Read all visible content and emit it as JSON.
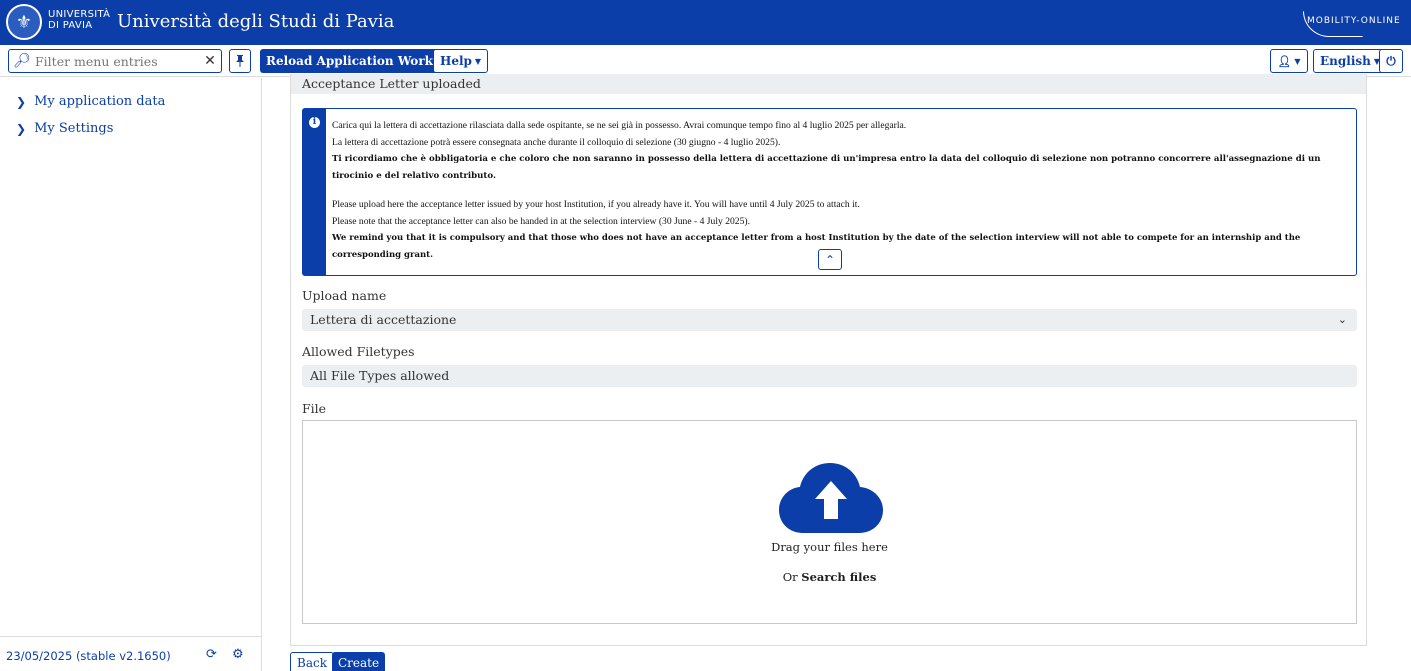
{
  "header": {
    "uni_small_line1": "UNIVERSITÀ",
    "uni_small_line2": "DI PAVIA",
    "title": "Università degli Studi di Pavia",
    "brand_logo_text": "MOBILITY-ONLINE",
    "brand_color": "#0b3ea8"
  },
  "toolbar": {
    "filter_placeholder": "Filter menu entries",
    "clear_icon": "close-icon",
    "pin_icon": "pin-icon",
    "reload_label": "Reload Application Workflow",
    "help_label": "Help",
    "user_icon": "user-settings-icon",
    "language_label": "English",
    "power_icon": "power-icon"
  },
  "sidebar": {
    "items": [
      {
        "label": "My application data"
      },
      {
        "label": "My Settings"
      }
    ],
    "version": "23/05/2025 (stable v2.1650)",
    "refresh_icon": "refresh-icon",
    "settings_icon": "gear-icon"
  },
  "main": {
    "section_title": "Acceptance Letter uploaded",
    "info": {
      "line1": "Carica qui la lettera di accettazione rilasciata dalla sede ospitante, se ne sei già in possesso. Avrai comunque tempo fino al 4 luglio 2025 per allegarla.",
      "line2": "La lettera di accettazione potrà essere consegnata anche durante il colloquio di selezione (30 giugno - 4 luglio 2025).",
      "line3": "Ti ricordiamo che è obbligatoria e che coloro che non saranno in possesso della lettera di accettazione di un'impresa entro la data del colloquio di selezione non potranno concorrere all'assegnazione di un tirocinio e del relativo contributo.",
      "line4": "Please upload here the acceptance letter issued by your host Institution, if you already have it. You will have until 4 July 2025 to attach it.",
      "line5": "Please note that the acceptance letter can also be handed in at the selection interview (30 June - 4 July 2025).",
      "line6": "We remind you that it is compulsory and that those who does not have an acceptance letter from a host Institution by the date of the selection interview will not able to compete for an internship and the corresponding grant."
    },
    "upload_name_label": "Upload name",
    "upload_name_value": "Lettera di accettazione",
    "filetypes_label": "Allowed Filetypes",
    "filetypes_value": "All File Types allowed",
    "file_label": "File",
    "dropzone": {
      "drag_text": "Drag your files here",
      "or_text": "Or ",
      "search_link": "Search files"
    }
  },
  "footer": {
    "back_label": "Back",
    "create_label": "Create"
  }
}
